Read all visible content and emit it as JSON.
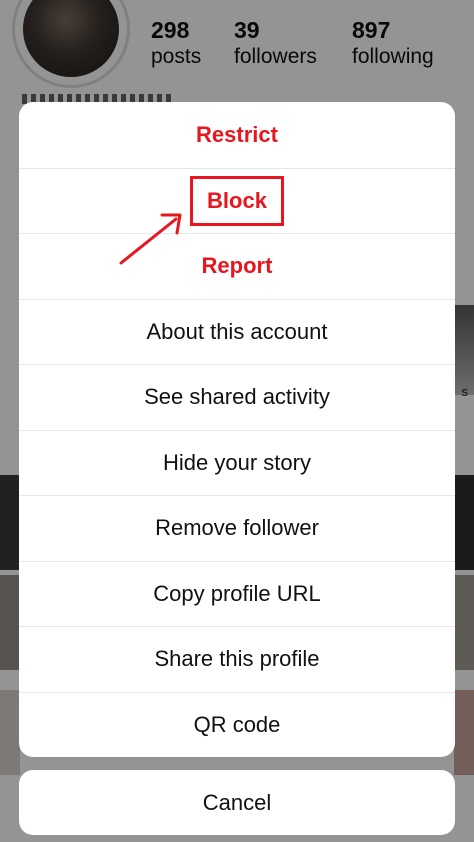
{
  "profile": {
    "stats": [
      {
        "num": "298",
        "label": "posts"
      },
      {
        "num": "39",
        "label": "followers"
      },
      {
        "num": "897",
        "label": "following"
      }
    ]
  },
  "sheet": {
    "restrict_label": "Restrict",
    "block_label": "Block",
    "report_label": "Report",
    "items": [
      "About this account",
      "See shared activity",
      "Hide your story",
      "Remove follower",
      "Copy profile URL",
      "Share this profile",
      "QR code"
    ],
    "cancel_label": "Cancel"
  },
  "colors": {
    "danger": "#e8161e",
    "annotation": "#e8161e",
    "scrim": "rgba(0,0,0,0.42)"
  }
}
